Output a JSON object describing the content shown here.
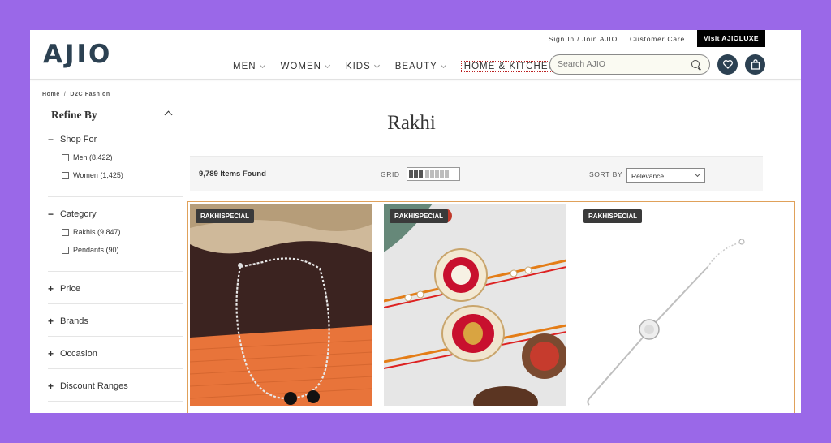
{
  "header": {
    "logo": "AJIO",
    "top_links": {
      "signin": "Sign In / Join AJIO",
      "customer_care": "Customer Care",
      "luxe": "Visit AJIOLUXE"
    },
    "nav": [
      {
        "label": "MEN"
      },
      {
        "label": "WOMEN"
      },
      {
        "label": "KIDS"
      },
      {
        "label": "BEAUTY"
      },
      {
        "label": "HOME & KITCHEN"
      }
    ],
    "search_placeholder": "Search AJIO"
  },
  "breadcrumb": [
    "Home",
    "D2C Fashion"
  ],
  "sidebar": {
    "title": "Refine By",
    "shop_for": {
      "label": "Shop For",
      "options": [
        {
          "label": "Men (8,422)"
        },
        {
          "label": "Women (1,425)"
        }
      ]
    },
    "category": {
      "label": "Category",
      "options": [
        {
          "label": "Rakhis (9,847)"
        },
        {
          "label": "Pendants (90)"
        }
      ]
    },
    "collapsed": [
      {
        "label": "Price"
      },
      {
        "label": "Brands"
      },
      {
        "label": "Occasion"
      },
      {
        "label": "Discount Ranges"
      }
    ]
  },
  "main": {
    "title": "Rakhi",
    "items_found": "9,789 Items Found",
    "grid_label": "GRID",
    "sort_label": "SORT BY",
    "sort_value": "Relevance",
    "products": [
      {
        "badge": "RAKHISPECIAL"
      },
      {
        "badge": "RAKHISPECIAL"
      },
      {
        "badge": "RAKHISPECIAL"
      }
    ]
  },
  "colors": {
    "brand": "#2c4152",
    "accent_border": "#e0a15a",
    "frame_bg": "#9a68e8"
  }
}
